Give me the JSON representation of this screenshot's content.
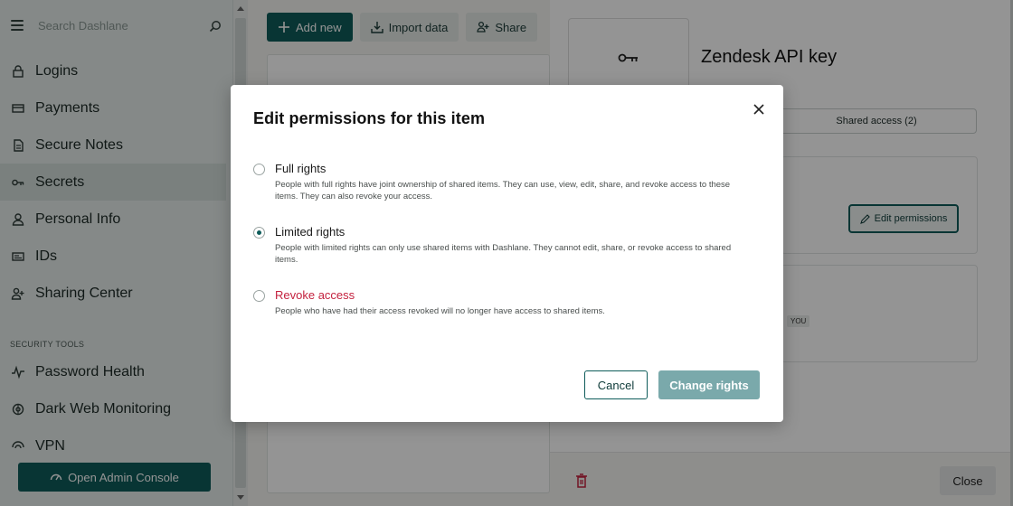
{
  "sidebar": {
    "search_placeholder": "Search Dashlane",
    "items": [
      {
        "label": "Logins",
        "icon": "lock-icon"
      },
      {
        "label": "Payments",
        "icon": "card-icon"
      },
      {
        "label": "Secure Notes",
        "icon": "note-icon"
      },
      {
        "label": "Secrets",
        "icon": "key-icon",
        "active": true
      },
      {
        "label": "Personal Info",
        "icon": "person-icon"
      },
      {
        "label": "IDs",
        "icon": "id-card-icon"
      },
      {
        "label": "Sharing Center",
        "icon": "sharing-icon"
      }
    ],
    "section_title": "SECURITY TOOLS",
    "security_items": [
      {
        "label": "Password Health",
        "icon": "pulse-icon"
      },
      {
        "label": "Dark Web Monitoring",
        "icon": "radar-icon"
      },
      {
        "label": "VPN",
        "icon": "vpn-icon"
      }
    ],
    "admin_button": "Open Admin Console"
  },
  "toolbar": {
    "add_new": "Add new",
    "import_data": "Import data",
    "share": "Share"
  },
  "detail": {
    "title": "Zendesk API key",
    "tab_shared_access": "Shared access (2)",
    "edit_permissions": "Edit permissions",
    "you_badge": "YOU",
    "close": "Close"
  },
  "modal": {
    "title": "Edit permissions for this item",
    "options": [
      {
        "label": "Full rights",
        "description": "People with full rights have joint ownership of shared items. They can use, view, edit, share, and revoke access to these items. They can also revoke your access.",
        "checked": false
      },
      {
        "label": "Limited rights",
        "description": "People with limited rights can only use shared items with Dashlane. They cannot edit, share, or revoke access to shared items.",
        "checked": true
      },
      {
        "label": "Revoke access",
        "description": "People who have had their access revoked will no longer have access to shared items.",
        "checked": false
      }
    ],
    "cancel": "Cancel",
    "confirm": "Change rights"
  },
  "colors": {
    "accent": "#0e5c5a",
    "danger": "#c4223f",
    "disabled_primary": "#7aa9ab"
  }
}
